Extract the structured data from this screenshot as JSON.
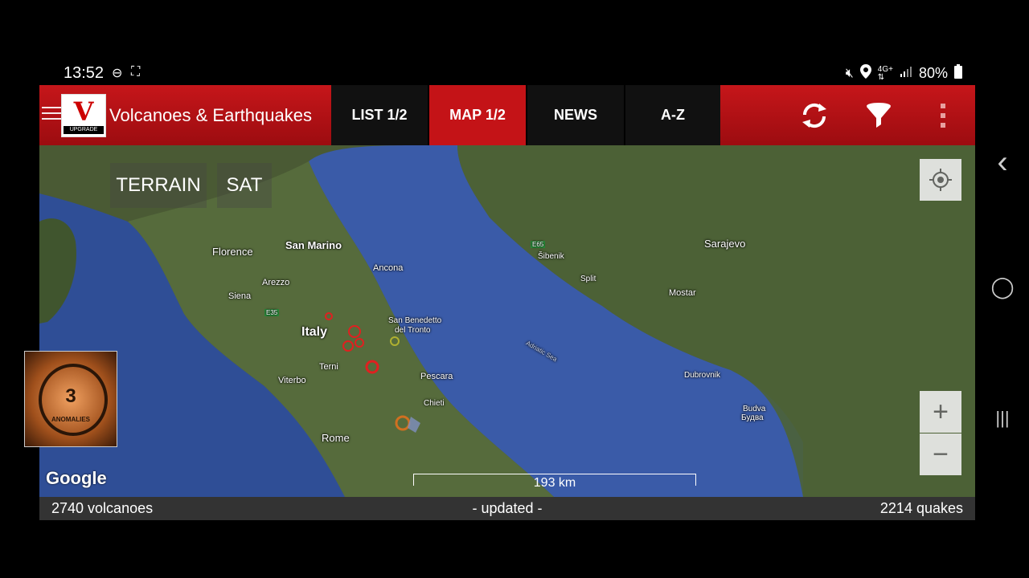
{
  "status_bar": {
    "time": "13:52",
    "battery": "80%",
    "icons": [
      "dnd-icon",
      "screenshot-icon",
      "mute-icon",
      "location-icon",
      "network-4g-icon",
      "signal-icon",
      "battery-icon"
    ]
  },
  "toolbar": {
    "app_title": "Volcanoes & Earthquakes",
    "logo_letter": "V",
    "logo_badge": "UPGRADE",
    "tabs": [
      {
        "label": "LIST 1/2",
        "active": false
      },
      {
        "label": "MAP 1/2",
        "active": true
      },
      {
        "label": "NEWS",
        "active": false
      },
      {
        "label": "A-Z",
        "active": false
      }
    ],
    "icons": [
      "refresh-icon",
      "filter-icon",
      "overflow-menu-icon"
    ],
    "accent_color": "#c41317"
  },
  "map": {
    "type_buttons": {
      "terrain": "TERRAIN",
      "sat": "SAT"
    },
    "labels": {
      "florence": "Florence",
      "san_marino": "San Marino",
      "ancona": "Ancona",
      "arezzo": "Arezzo",
      "siena": "Siena",
      "e35": "E35",
      "italy": "Italy",
      "san_benedetto": "San Benedetto",
      "del_tronto": "del Tronto",
      "terni": "Terni",
      "viterbo": "Viterbo",
      "pescara": "Pescara",
      "chieti": "Chieti",
      "rome": "Rome",
      "e65": "E65",
      "sibenik": "Šibenik",
      "split": "Split",
      "sarajevo": "Sarajevo",
      "mostar": "Mostar",
      "adriatic_sea": "Adriatic Sea",
      "dubrovnik": "Dubrovnik",
      "budva": "Budva",
      "budva_cyr": "Будва"
    },
    "attribution": "Google",
    "scale_label": "193 km",
    "zoom_in": "+",
    "zoom_out": "−",
    "quake_color": "#e02020",
    "volcano_color": "#d07020"
  },
  "footer": {
    "volcano_count": "2740 volcanoes",
    "status": "-  updated  -",
    "quake_count": "2214 quakes"
  },
  "overlay": {
    "number": "3",
    "text": "ANOMALIES"
  },
  "nav_buttons": {
    "back": "‹",
    "home": "◯",
    "recents": "|||"
  }
}
